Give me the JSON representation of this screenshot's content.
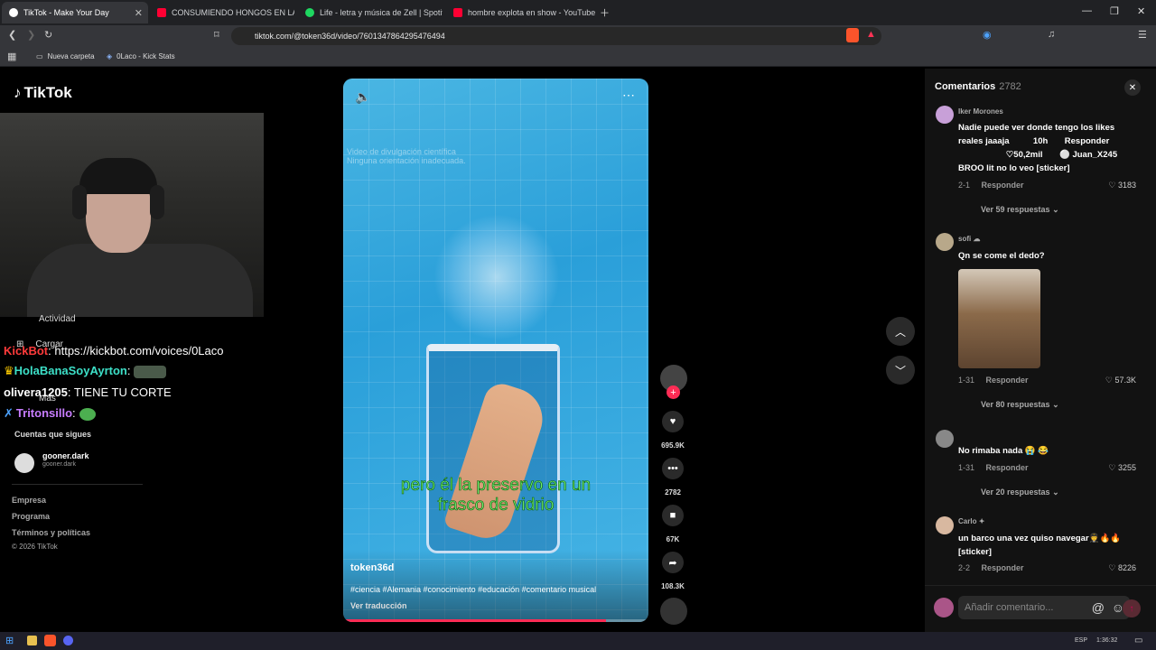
{
  "browser": {
    "tabs": [
      {
        "title": "TikTok - Make Your Day",
        "color": "#ffffff"
      },
      {
        "title": "CONSUMIENDO HONGOS EN LAS SI",
        "color": "#ff0033"
      },
      {
        "title": "Life - letra y música de Zell | Spotify",
        "color": "#1ed760"
      },
      {
        "title": "hombre explota en show - YouTube",
        "color": "#ff0033"
      }
    ],
    "url": "tiktok.com/@token36d/video/7601347864295476494",
    "bookmarks": [
      "Nueva carpeta",
      "0Laco - Kick Stats"
    ]
  },
  "sidebar": {
    "logo": "TikTok",
    "menu": [
      "Actividad",
      "Cargar",
      "Más"
    ],
    "following_title": "Cuentas que sigues",
    "account": {
      "name": "gooner.dark",
      "handle": "gooner.dark"
    },
    "footer": [
      "Empresa",
      "Programa",
      "Términos y políticas",
      "© 2026 TikTok"
    ]
  },
  "stream_chat": [
    {
      "user": "KickBot",
      "sep": ": ",
      "msg": "https://kickbot.com/voices/0Laco",
      "color": "#ff3b3b"
    },
    {
      "user": "HolaBanaSoyAyrton",
      "sep": ": ",
      "msg": "",
      "color": "#3de0c8"
    },
    {
      "user": "olivera1205",
      "sep": ": ",
      "msg": "TIENE TU CORTE",
      "color": "#ffffff"
    },
    {
      "user": "Tritonsillo",
      "sep": ":",
      "msg": "",
      "color": "#c87dff"
    }
  ],
  "video": {
    "overlay_text": "Video de divulgación científica\nNinguna orientación inadecuada.",
    "caption_line1": "pero él la preservo en un",
    "caption_line2": "frasco de vidrio",
    "author": "token36d",
    "hashtags": "#ciencia #Alemania #conocimiento #educación #comentario musical",
    "translate": "Ver traducción",
    "progress": 0.86
  },
  "actions": {
    "likes": "695.9K",
    "comments": "2782",
    "saves": "67K",
    "shares": "108.3K"
  },
  "comments_panel": {
    "title": "Comentarios",
    "count": "2782",
    "comments": [
      {
        "user": "Iker Morones",
        "text_lines": [
          "Nadie puede ver donde tengo los likes",
          "reales jaaaja          10h       Responder",
          "                    ♡50,2mil       ⚪ Juan_X245",
          "BROO lit no lo veo [sticker]"
        ],
        "date": "2-1",
        "reply": "Responder",
        "likes": "3183",
        "more": "Ver 59 respuestas"
      },
      {
        "user": "sofi",
        "text_lines": [
          "Qn se come el dedo?"
        ],
        "date": "1-31",
        "reply": "Responder",
        "likes": "57.3K",
        "more": "Ver 80 respuestas"
      },
      {
        "user": "",
        "text_lines": [
          "No rimaba nada 😭 😂"
        ],
        "date": "1-31",
        "reply": "Responder",
        "likes": "3255",
        "more": "Ver 20 respuestas"
      },
      {
        "user": "Carlo",
        "text_lines": [
          "un barco una vez quiso navegar🧑‍✈️🔥🔥",
          "[sticker]"
        ],
        "date": "2-2",
        "reply": "Responder",
        "likes": "8226",
        "more": ""
      }
    ],
    "input_placeholder": "Añadir comentario..."
  },
  "taskbar": {
    "lang": "ESP",
    "time": "1:36:32"
  }
}
